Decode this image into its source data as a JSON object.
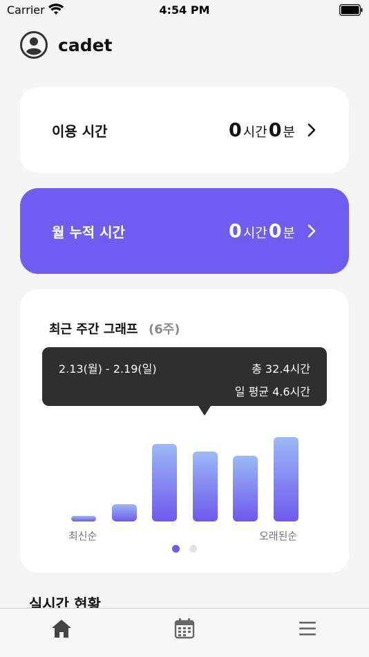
{
  "status_bar": {
    "carrier": "Carrier",
    "time": "4:54 PM"
  },
  "profile": {
    "username": "cadet"
  },
  "usage_card": {
    "label": "이용 시간",
    "hours": "0",
    "hours_unit": "시간",
    "minutes": "0",
    "minutes_unit": "분"
  },
  "monthly_card": {
    "label": "월 누적 시간",
    "hours": "0",
    "hours_unit": "시간",
    "minutes": "0",
    "minutes_unit": "분"
  },
  "weekly_graph": {
    "title": "최근 주간 그래프",
    "subtitle": "(6주)",
    "tooltip": {
      "range": "2.13(월) - 2.19(일)",
      "total": "총 32.4시간",
      "average": "일 평균  4.6시간"
    },
    "axis_left_label": "최신순",
    "axis_right_label": "오래된순",
    "page_indicator": {
      "current": 1,
      "total": 2
    }
  },
  "chart_data": {
    "type": "bar",
    "categories": [
      "",
      "",
      "",
      "",
      "",
      ""
    ],
    "values": [
      2.4,
      7.2,
      32.4,
      29.2,
      27.5,
      35.5
    ],
    "ylim": [
      0,
      36
    ]
  },
  "realtime": {
    "title": "실시간 현황"
  },
  "tab_bar": {
    "items": [
      "home-icon",
      "calendar-icon",
      "menu-icon"
    ]
  },
  "colors": {
    "accent": "#6e5df0",
    "tooltip_bg": "#2f2f2f",
    "bar_top": "#9bbaf5",
    "bar_bottom": "#6f58ee"
  }
}
